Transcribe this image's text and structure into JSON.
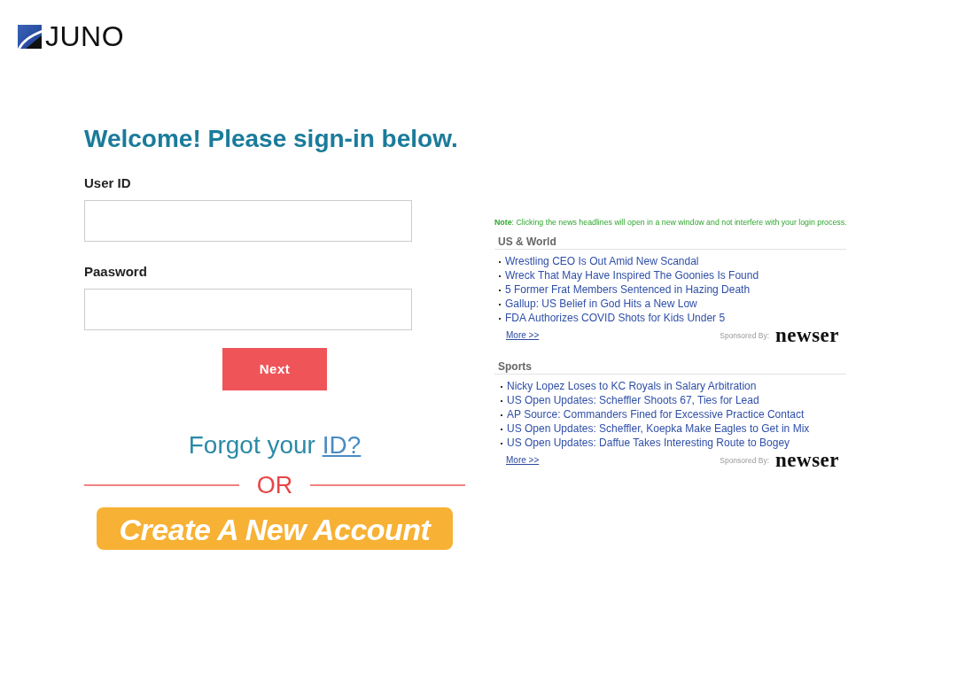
{
  "logo": {
    "text": "JUNO"
  },
  "heading": "Welcome! Please sign-in below.",
  "fields": [
    {
      "label": "User ID"
    },
    {
      "label": "Paasword"
    }
  ],
  "next_button": "Next",
  "forgot": {
    "text": "Forgot your",
    "link": "ID?"
  },
  "divider_text": "OR",
  "create_account_button": "Create A New Account",
  "news": {
    "note": "**Note**: Clicking the news headlines will open in a new window and not interfere with your login process.",
    "sections": [
      {
        "title": "US & World",
        "headlines": [
          "Wrestling CEO Is Out Amid New Scandal",
          "Wreck That May Have Inspired The Goonies Is Found",
          "5 Former Frat Members Sentenced in Hazing Death",
          "Gallup: US Belief in God Hits a New Low",
          "FDA Authorizes COVID Shots for Kids Under 5"
        ],
        "more_link": "More >>",
        "sponsor_label": "Sponsored By:",
        "sponsor_logo": "newser"
      },
      {
        "title": "Sports",
        "headlines": [
          "Nicky Lopez Loses to KC Royals in Salary Arbitration",
          "US Open Updates: Scheffler Shoots 67, Ties for Lead",
          "AP Source: Commanders Fined for Excessive Practice Contact",
          "US Open Updates: Scheffler, Koepka Make Eagles to Get in Mix",
          "US Open Updates: Daffue Takes Interesting Route to Bogey"
        ],
        "more_link": "More >>",
        "sponsor_label": "Sponsored By:",
        "sponsor_logo": "newser"
      }
    ]
  }
}
